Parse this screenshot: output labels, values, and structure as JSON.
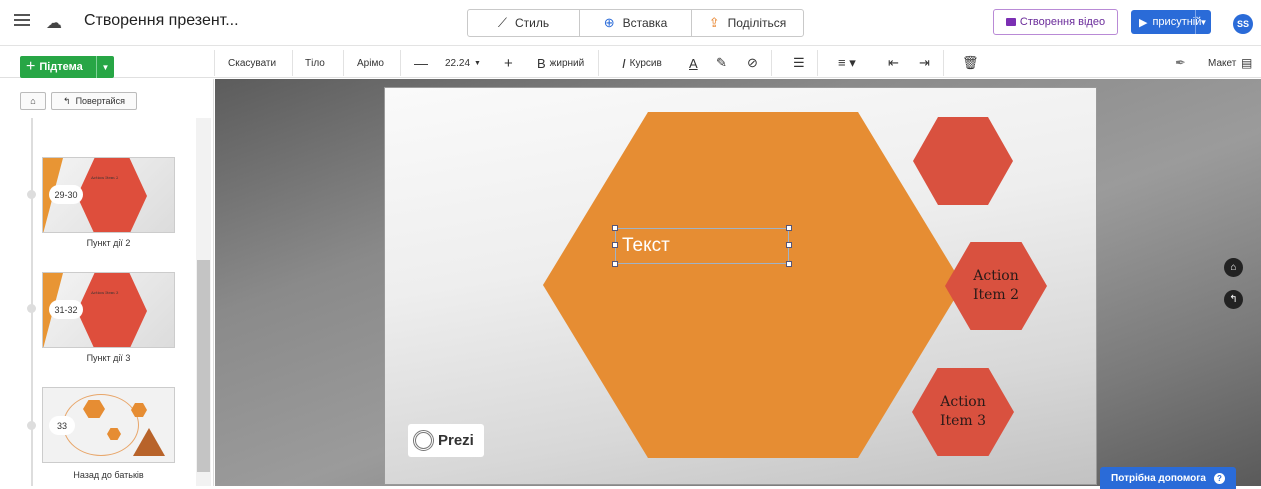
{
  "header": {
    "title": "Створення презент...",
    "tabs": [
      {
        "label": "Стиль",
        "icon": "magic-wand-icon"
      },
      {
        "label": "Вставка",
        "icon": "plus-circle-icon"
      },
      {
        "label": "Поділіться",
        "icon": "share-icon"
      }
    ],
    "video_label": "Створення відео",
    "present_label": "присутній",
    "avatar_initials": "SS",
    "colors": {
      "accent": "#2a6bd8",
      "video": "#7b2fb3",
      "green": "#27a645"
    }
  },
  "toolbar": {
    "subtopic_label": "Підтема",
    "undo": "Скасувати",
    "body": "Тіло",
    "font": "Арімо",
    "font_size": "22.24",
    "bold_glyph": "B",
    "bold": "жирний",
    "italic_glyph": "I",
    "italic": "Курсив",
    "text_color_glyph": "A",
    "layout": "Макет"
  },
  "sidebar": {
    "back_label": "Повертайся",
    "items": [
      {
        "range": "29-30",
        "label": "Пункт дії 2",
        "mini_title": "Action Item 2"
      },
      {
        "range": "31-32",
        "label": "Пункт дії 3",
        "mini_title": "Action Item 3"
      },
      {
        "range": "33",
        "label": "Назад до батьків",
        "mini_title": ""
      }
    ]
  },
  "slide": {
    "textbox_value": "Текст",
    "item2": "Action Item 2",
    "item3": "Action Item 3",
    "logo_text": "Prezi",
    "colors": {
      "orange": "#e68d33",
      "red": "#d9513f"
    }
  },
  "help_label": "Потрібна допомога"
}
